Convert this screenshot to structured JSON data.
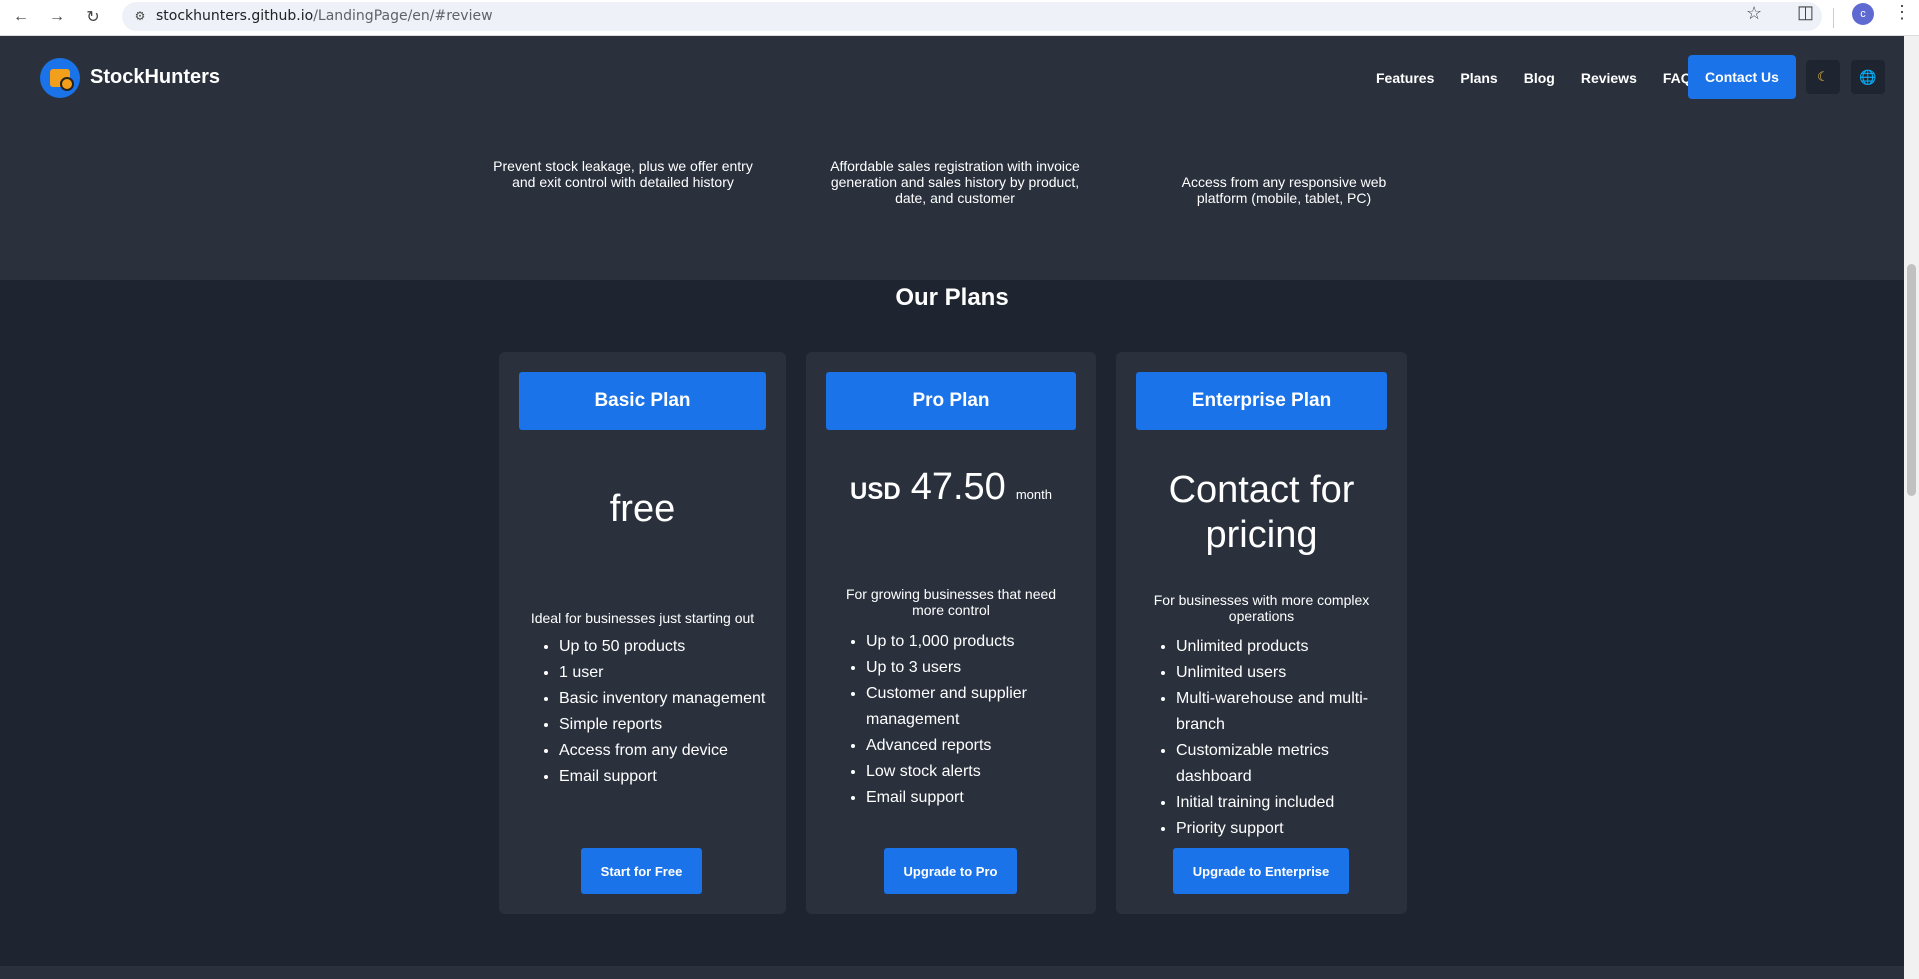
{
  "browser": {
    "url_host": "stockhunters.github.io",
    "url_path": "/LandingPage/en/#review",
    "profile_initial": "c",
    "icons": [
      "back-icon",
      "forward-icon",
      "reload-icon",
      "site-info-icon",
      "star-icon",
      "extensions-icon",
      "menu-icon"
    ]
  },
  "header": {
    "brand": "StockHunters",
    "nav": [
      "Features",
      "Plans",
      "Blog",
      "Reviews",
      "FAQ"
    ],
    "contact_label": "Contact Us",
    "theme_icon": "moon-icon",
    "language_icon": "globe-icon"
  },
  "features": {
    "items": [
      "Prevent stock leakage, plus we offer entry and exit control with detailed history",
      "Affordable sales registration with invoice generation and sales history by product, date, and customer",
      "Access from any responsive web platform (mobile, tablet, PC)"
    ]
  },
  "plans": {
    "title": "Our Plans",
    "basic": {
      "name": "Basic Plan",
      "price": "free",
      "description": "Ideal for businesses just starting out",
      "features": [
        "Up to 50 products",
        "1 user",
        "Basic inventory management",
        "Simple reports",
        "Access from any device",
        "Email support"
      ],
      "button": "Start for Free"
    },
    "pro": {
      "name": "Pro Plan",
      "currency": "USD",
      "price": "47.50",
      "period": "month",
      "description": "For growing businesses that need more control",
      "features": [
        "Up to 1,000 products",
        "Up to 3 users",
        "Customer and supplier management",
        "Advanced reports",
        "Low stock alerts",
        "Email support"
      ],
      "button": "Upgrade to Pro"
    },
    "enterprise": {
      "name": "Enterprise Plan",
      "price": "Contact for pricing",
      "description": "For businesses with more complex operations",
      "features": [
        "Unlimited products",
        "Unlimited users",
        "Multi-warehouse and multi-branch",
        "Customizable metrics dashboard",
        "Initial training included",
        "Priority support"
      ],
      "button": "Upgrade to Enterprise"
    }
  },
  "colors": {
    "accent": "#1a73e8",
    "background": "#1f2530",
    "surface": "#2a313d"
  }
}
